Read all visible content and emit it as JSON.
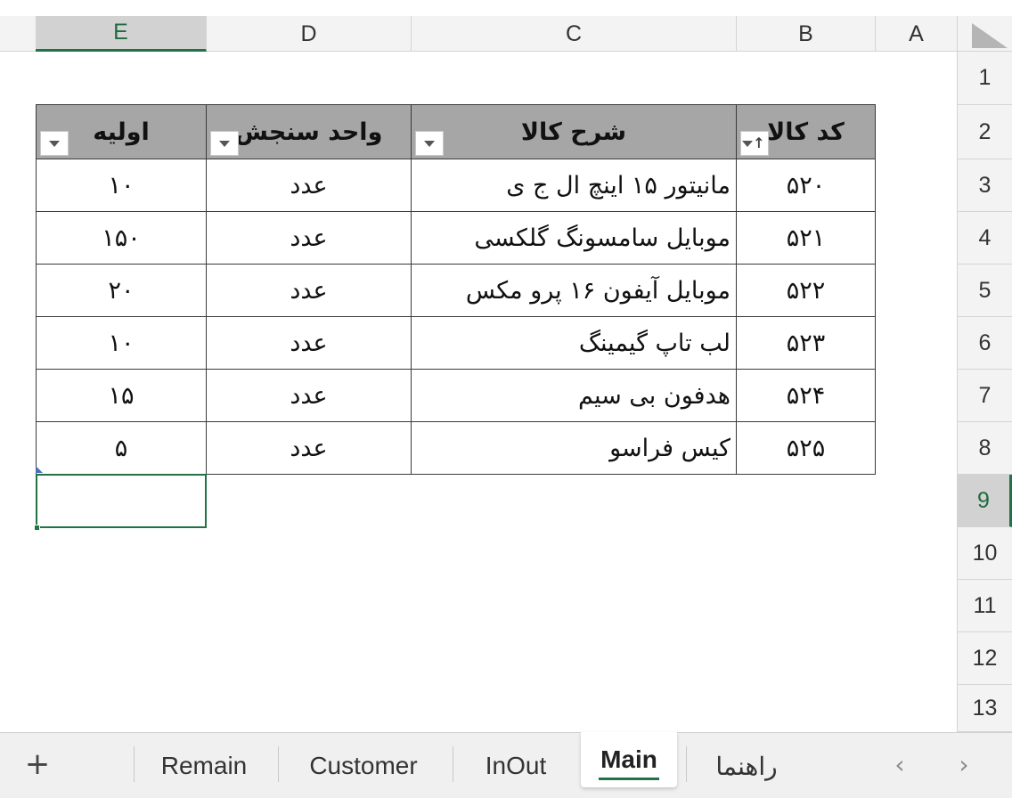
{
  "columns": [
    "E",
    "D",
    "C",
    "B",
    "A"
  ],
  "rows": [
    "1",
    "2",
    "3",
    "4",
    "5",
    "6",
    "7",
    "8",
    "9",
    "10",
    "11",
    "12",
    "13"
  ],
  "table": {
    "headers": {
      "code": "کد کالا",
      "description": "شرح کالا",
      "unit": "واحد سنجش",
      "initial": "اولیه"
    },
    "data": [
      {
        "code": "۵۲۰",
        "description": "مانیتور ۱۵ اینچ ال ج ی",
        "unit": "عدد",
        "initial": "۱۰"
      },
      {
        "code": "۵۲۱",
        "description": "موبایل سامسونگ گلکسی",
        "unit": "عدد",
        "initial": "۱۵۰"
      },
      {
        "code": "۵۲۲",
        "description": "موبایل آیفون ۱۶ پرو مکس",
        "unit": "عدد",
        "initial": "۲۰"
      },
      {
        "code": "۵۲۳",
        "description": "لب تاپ گیمینگ",
        "unit": "عدد",
        "initial": "۱۰"
      },
      {
        "code": "۵۲۴",
        "description": "هدفون بی سیم",
        "unit": "عدد",
        "initial": "۱۵"
      },
      {
        "code": "۵۲۵",
        "description": "کیس فراسو",
        "unit": "عدد",
        "initial": "۵"
      }
    ]
  },
  "sheets": {
    "add_label": "+",
    "tabs": [
      "Remain",
      "Customer",
      "InOut",
      "Main",
      "راهنما"
    ],
    "active": "Main"
  },
  "nav": {
    "prev": "‹",
    "next": "›"
  },
  "colors": {
    "accent": "#217346",
    "header_fill": "#a6a6a6"
  }
}
